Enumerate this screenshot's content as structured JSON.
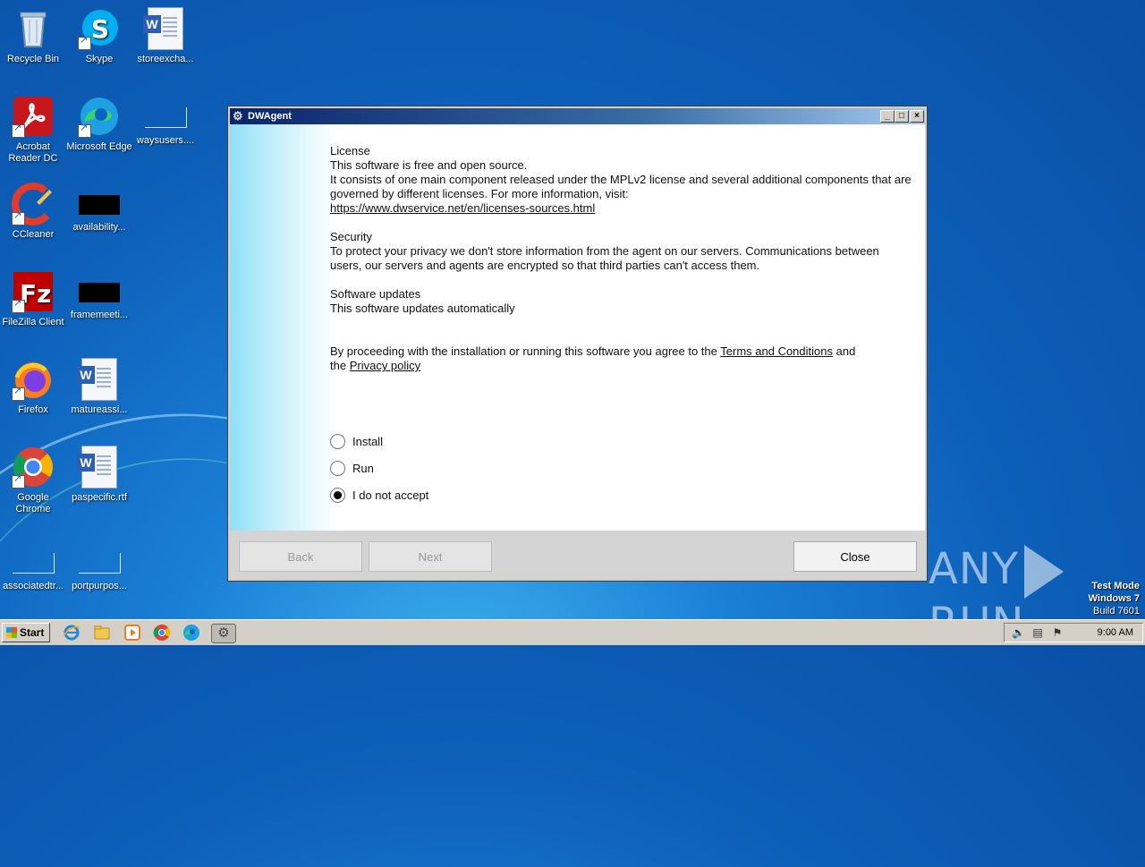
{
  "desktop": {
    "icons": [
      {
        "label": "Recycle Bin"
      },
      {
        "label": "Skype"
      },
      {
        "label": "storeexcha..."
      },
      {
        "label": "Acrobat Reader DC"
      },
      {
        "label": "Microsoft Edge"
      },
      {
        "label": "waysusers...."
      },
      {
        "label": "CCleaner"
      },
      {
        "label": "availability..."
      },
      {
        "label": "FileZilla Client"
      },
      {
        "label": "framemeeti..."
      },
      {
        "label": "Firefox"
      },
      {
        "label": "matureassi..."
      },
      {
        "label": "Google Chrome"
      },
      {
        "label": "paspecific.rtf"
      },
      {
        "label": "associatedtr..."
      },
      {
        "label": "portpurpos..."
      }
    ]
  },
  "window": {
    "title": "DWAgent",
    "controls": {
      "minimize": "_",
      "maximize": "□",
      "close": "×"
    },
    "license_heading": "License",
    "license_line1": "This software is free and open source.",
    "license_line2": "It consists of one main component released under the MPLv2 license and several additional components that are governed by different licenses. For more information, visit:",
    "license_link": "https://www.dwservice.net/en/licenses-sources.html",
    "security_heading": "Security",
    "security_text": "To protect your privacy we don't store information from the agent on our servers. Communications between users, our servers and agents are encrypted so that third parties can't access them.",
    "updates_heading": "Software updates",
    "updates_text": "This software updates automatically",
    "agree_prefix": "By proceeding with the installation or running this software you agree to the",
    "terms_link": "Terms and Conditions",
    "agree_and": "and",
    "agree_the": "the",
    "privacy_link": "Privacy policy",
    "options": [
      {
        "label": "Install",
        "selected": false
      },
      {
        "label": "Run",
        "selected": false
      },
      {
        "label": "I do not accept",
        "selected": true
      }
    ],
    "buttons": {
      "back": "Back",
      "next": "Next",
      "close": "Close"
    }
  },
  "watermark": {
    "left": "ANY",
    "right": "RUN"
  },
  "os_badge": {
    "line1": "Test Mode",
    "line2": "Windows 7",
    "line3": "Build 7601"
  },
  "taskbar": {
    "start_label": "Start",
    "clock": "9:00 AM",
    "pinned": [
      "ie-icon",
      "explorer-icon",
      "media-player-icon",
      "chrome-icon",
      "edge-icon",
      "dwagent-icon"
    ]
  }
}
